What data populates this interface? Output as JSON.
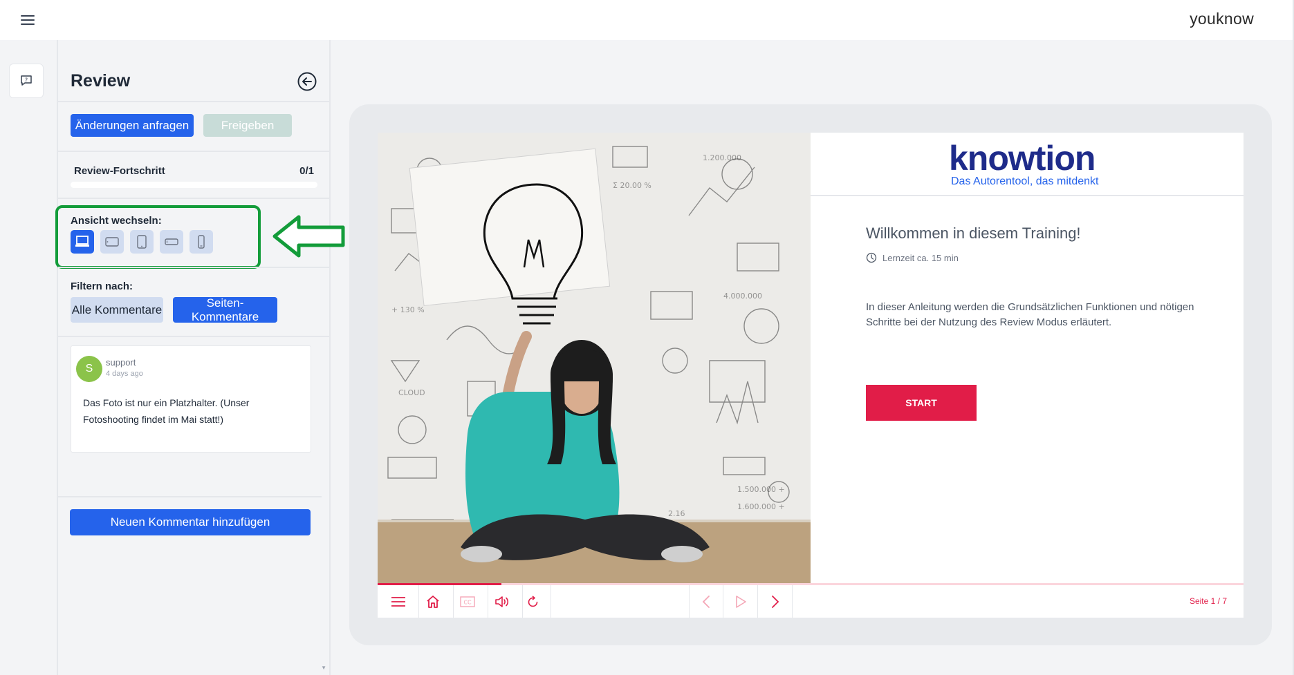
{
  "app": {
    "brand": "youknow"
  },
  "panel": {
    "title": "Review",
    "request_changes_label": "Änderungen anfragen",
    "approve_label": "Freigeben",
    "progress_label": "Review-Fortschritt",
    "progress_count": "0/1",
    "progress_fraction": 0,
    "view_label": "Ansicht wechseln:",
    "views": [
      "desktop",
      "tablet-landscape",
      "tablet-portrait",
      "phone-landscape",
      "phone-portrait"
    ],
    "active_view": "desktop",
    "filter_label": "Filtern nach:",
    "filter_all_label": "Alle Kommentare",
    "filter_page_label": "Seiten-Kommentare",
    "comment": {
      "avatar_letter": "S",
      "author": "support",
      "time": "4 days ago",
      "text": "Das Foto ist nur ein Platzhalter. (Unser Fotoshooting findet im Mai statt!)"
    },
    "add_comment_label": "Neuen Kommentar hinzufügen"
  },
  "slide": {
    "logo_word": "knowtion",
    "logo_tagline": "Das Autorentool, das mitdenkt",
    "welcome": "Willkommen in diesem Training!",
    "duration": "Lernzeit ca. 15 min",
    "description": "In dieser Anleitung werden die Grundsätzlichen Funktionen und nötigen Schritte bei der Nutzung des Review Modus erläutert.",
    "start_label": "START"
  },
  "player": {
    "page_indicator": "Seite 1 / 7",
    "progress_fraction": 0.1429
  },
  "colors": {
    "primary": "#2563eb",
    "accent_red": "#e11d48",
    "highlight_green": "#139c3a"
  }
}
